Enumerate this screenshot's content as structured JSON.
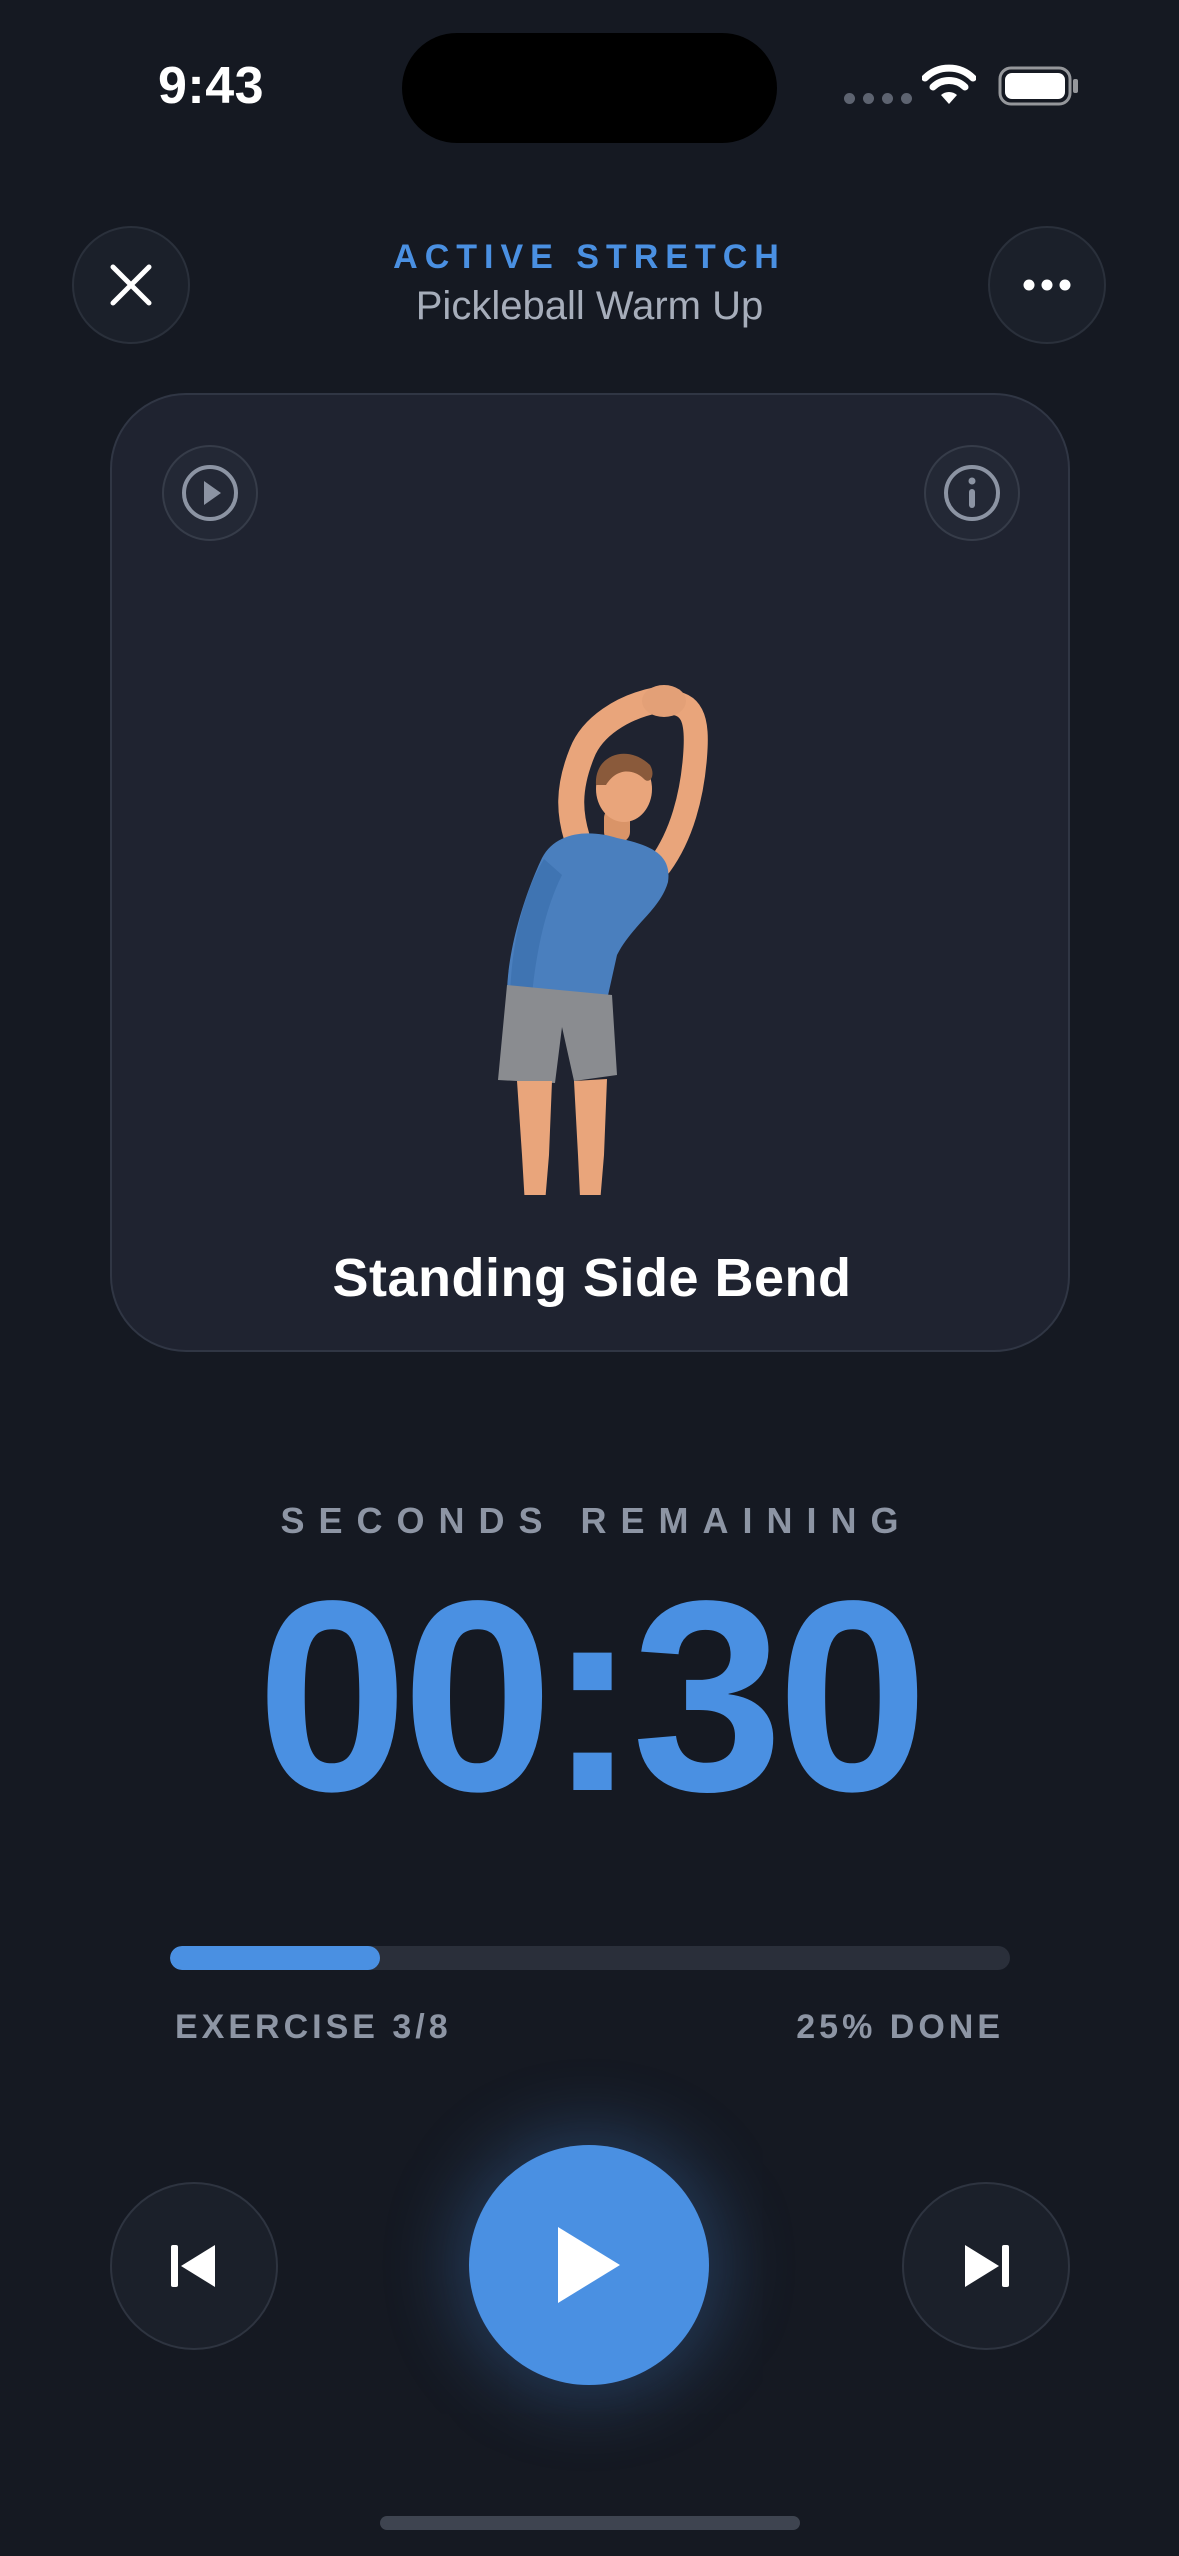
{
  "status_bar": {
    "time": "9:43"
  },
  "header": {
    "category": "ACTIVE STRETCH",
    "workout_name": "Pickleball Warm Up",
    "close_icon": "close-icon",
    "more_icon": "more-horizontal-icon"
  },
  "card": {
    "play_icon": "play-circle-icon",
    "info_icon": "info-icon",
    "exercise_name": "Standing Side Bend"
  },
  "timer": {
    "label": "SECONDS REMAINING",
    "value": "00:30"
  },
  "progress": {
    "fraction": 0.25,
    "exercise_text": "EXERCISE 3/8",
    "done_text": "25% DONE"
  },
  "controls": {
    "previous_icon": "skip-previous-icon",
    "play_icon": "play-icon",
    "next_icon": "skip-next-icon"
  },
  "colors": {
    "accent": "#4a90e2",
    "background": "#151922",
    "card": "#1f2330"
  }
}
